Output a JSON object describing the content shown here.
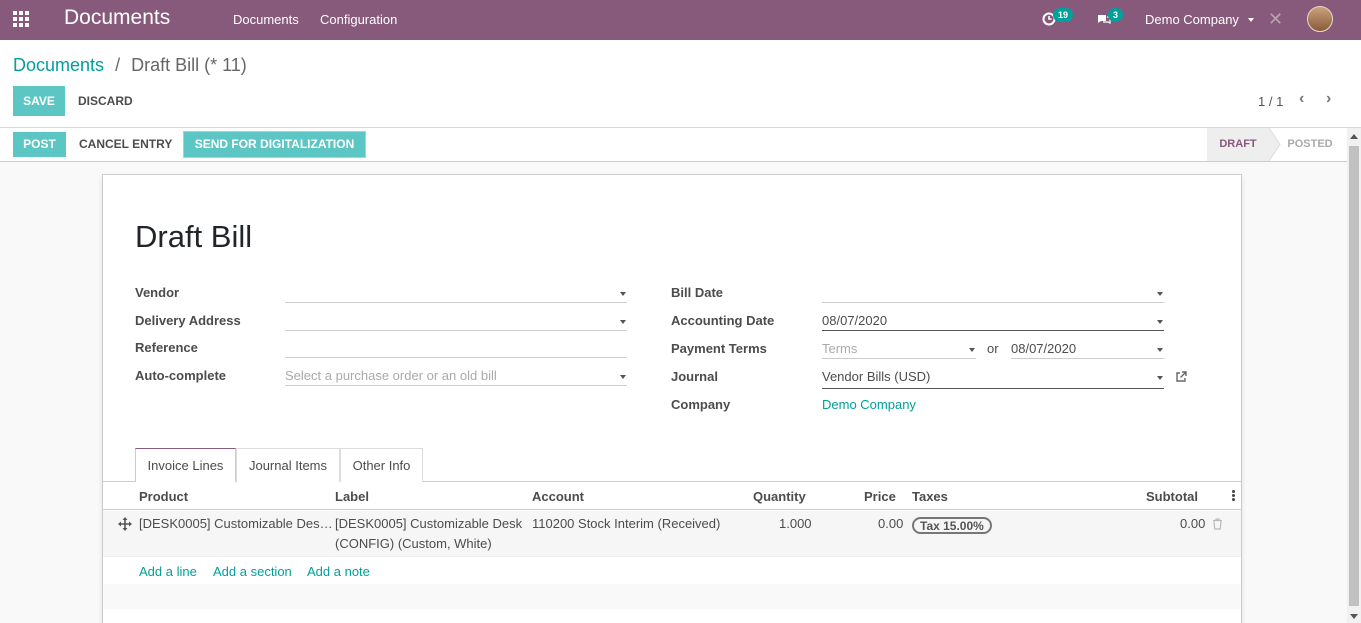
{
  "navbar": {
    "app_name": "Documents",
    "menu": [
      "Documents",
      "Configuration"
    ],
    "activity_count": "19",
    "message_count": "3",
    "company": "Demo Company"
  },
  "breadcrumb": {
    "parent": "Documents",
    "separator": "/",
    "current": "Draft Bill (* 11)"
  },
  "actions": {
    "save": "SAVE",
    "discard": "DISCARD"
  },
  "pager": {
    "value": "1 / 1"
  },
  "statusbar": {
    "post": "POST",
    "cancel_entry": "CANCEL ENTRY",
    "send_digitalization": "SEND FOR DIGITALIZATION",
    "steps": [
      "DRAFT",
      "POSTED"
    ],
    "active_step": "DRAFT"
  },
  "form": {
    "title": "Draft Bill",
    "left": {
      "vendor_label": "Vendor",
      "vendor_value": "",
      "delivery_label": "Delivery Address",
      "delivery_value": "",
      "reference_label": "Reference",
      "reference_value": "",
      "autocomplete_label": "Auto-complete",
      "autocomplete_placeholder": "Select a purchase order or an old bill"
    },
    "right": {
      "bill_date_label": "Bill Date",
      "bill_date_value": "",
      "accounting_date_label": "Accounting Date",
      "accounting_date_value": "08/07/2020",
      "payment_terms_label": "Payment Terms",
      "payment_terms_placeholder": "Terms",
      "or_text": "or",
      "due_date_value": "08/07/2020",
      "journal_label": "Journal",
      "journal_value": "Vendor Bills (USD)",
      "company_label": "Company",
      "company_value": "Demo Company"
    }
  },
  "tabs": [
    "Invoice Lines",
    "Journal Items",
    "Other Info"
  ],
  "table": {
    "columns": [
      "Product",
      "Label",
      "Account",
      "Quantity",
      "Price",
      "Taxes",
      "Subtotal"
    ],
    "rows": [
      {
        "product": "[DESK0005] Customizable Des…",
        "label_line1": "[DESK0005] Customizable Desk",
        "label_line2": "(CONFIG) (Custom, White)",
        "account": "110200 Stock Interim (Received)",
        "quantity": "1.000",
        "price": "0.00",
        "tax": "Tax 15.00%",
        "subtotal": "0.00"
      }
    ],
    "add_line": "Add a line",
    "add_section": "Add a section",
    "add_note": "Add a note"
  },
  "colors": {
    "brand": "#875a7b",
    "accent": "#00a09d",
    "primary_button": "#5cc6c4"
  }
}
